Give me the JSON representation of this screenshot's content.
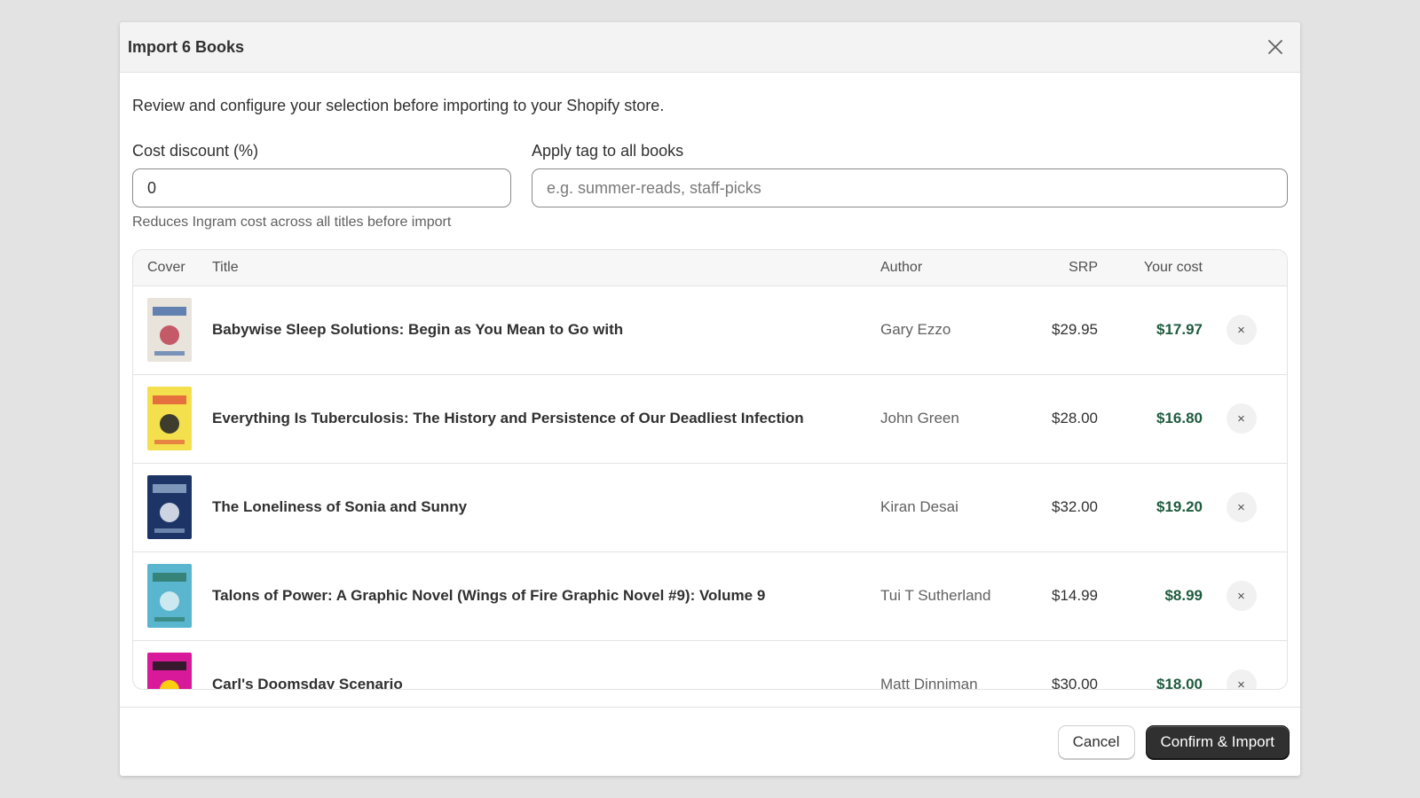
{
  "modal": {
    "title": "Import 6 Books",
    "close_icon": "close-icon"
  },
  "intro": "Review and configure your selection before importing to your Shopify store.",
  "discount": {
    "label": "Cost discount (%)",
    "value": "0",
    "help": "Reduces Ingram cost across all titles before import"
  },
  "tag": {
    "label": "Apply tag to all books",
    "placeholder": "e.g. summer-reads, staff-picks"
  },
  "table": {
    "headers": {
      "cover": "Cover",
      "title": "Title",
      "author": "Author",
      "srp": "SRP",
      "cost": "Your cost"
    },
    "rows": [
      {
        "title": "Babywise Sleep Solutions: Begin as You Mean to Go with",
        "author": "Gary Ezzo",
        "srp": "$29.95",
        "cost": "$17.97",
        "remove": "×",
        "cover_colors": [
          "#e8e4dc",
          "#4a6fa8",
          "#c04a5a"
        ]
      },
      {
        "title": "Everything Is Tuberculosis: The History and Persistence of Our Deadliest Infection",
        "author": "John Green",
        "srp": "$28.00",
        "cost": "$16.80",
        "remove": "×",
        "cover_colors": [
          "#f4e04d",
          "#e25c3c",
          "#2a2a2a"
        ]
      },
      {
        "title": "The Loneliness of Sonia and Sunny",
        "author": "Kiran Desai",
        "srp": "$32.00",
        "cost": "$19.20",
        "remove": "×",
        "cover_colors": [
          "#1c3566",
          "#8fa7c9",
          "#e0e6f0"
        ]
      },
      {
        "title": "Talons of Power: A Graphic Novel (Wings of Fire Graphic Novel #9): Volume 9",
        "author": "Tui T Sutherland",
        "srp": "$14.99",
        "cost": "$8.99",
        "remove": "×",
        "cover_colors": [
          "#5ab5cf",
          "#2f7a6a",
          "#d8eef2"
        ]
      },
      {
        "title": "Carl's Doomsday Scenario",
        "author": "Matt Dinniman",
        "srp": "$30.00",
        "cost": "$18.00",
        "remove": "×",
        "cover_colors": [
          "#d81a9a",
          "#1a1a1a",
          "#ffe000"
        ]
      }
    ]
  },
  "footer": {
    "cancel": "Cancel",
    "confirm": "Confirm & Import"
  }
}
